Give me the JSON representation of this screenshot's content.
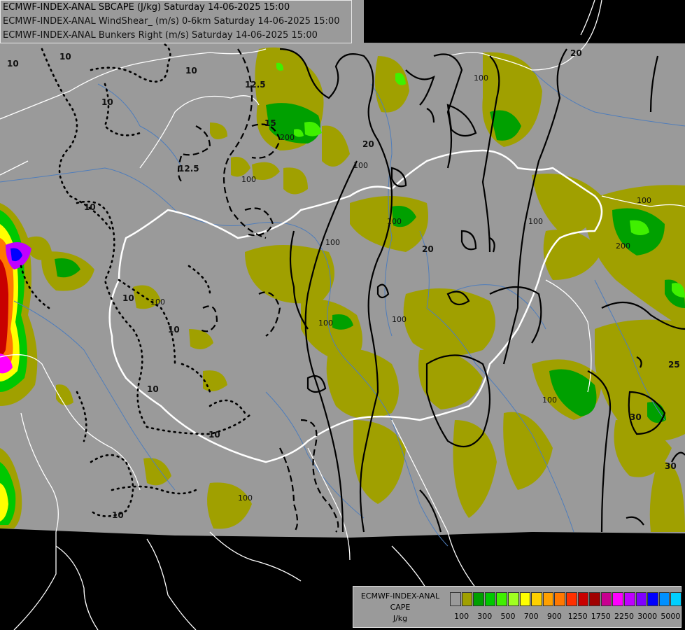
{
  "titles": {
    "line1": "ECMWF-INDEX-ANAL SBCAPE (J/kg) Saturday 14-06-2025 15:00",
    "line2": "ECMWF-INDEX-ANAL WindShear_ (m/s) 0-6km Saturday 14-06-2025 15:00",
    "line3": "ECMWF-INDEX-ANAL Bunkers Right (m/s) Saturday 14-06-2025 15:00"
  },
  "legend": {
    "model": "ECMWF-INDEX-ANAL",
    "field": "CAPE",
    "unit": "J/kg",
    "colors": [
      "#9a9a9a",
      "#a0a000",
      "#00a000",
      "#00c800",
      "#40f000",
      "#a0ff20",
      "#ffff00",
      "#ffd000",
      "#ffa000",
      "#ff7800",
      "#ff3000",
      "#c80000",
      "#a00000",
      "#c80090",
      "#ff00ff",
      "#c000ff",
      "#8000ff",
      "#0000ff",
      "#0090ff",
      "#00d0ff",
      "#80ffff",
      "#ffffff"
    ],
    "ticks": [
      "100",
      "300",
      "500",
      "700",
      "900",
      "1250",
      "1750",
      "2250",
      "3000",
      "5000"
    ]
  },
  "map_labels": {
    "cape": [
      "100",
      "200"
    ],
    "shear": [
      "10",
      "20",
      "25",
      "30"
    ],
    "bunkers": [
      "10",
      "12.5",
      "15"
    ]
  },
  "colors": {
    "background": "#000000",
    "domain": "#9a9a9a",
    "cape_100": "#a0a000",
    "cape_300": "#00a000",
    "cape_500": "#40f000",
    "border": "#ffffff",
    "river": "#4f7dbb"
  }
}
